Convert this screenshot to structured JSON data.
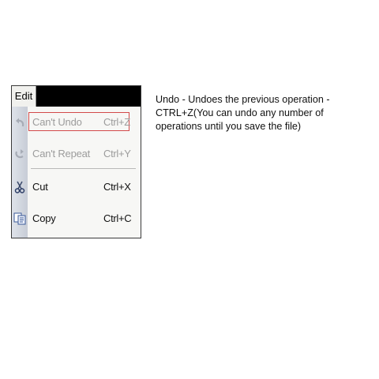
{
  "menu": {
    "title": "Edit",
    "items": [
      {
        "label": "Can't Undo",
        "shortcut": "Ctrl+Z",
        "icon": "undo-arrow-icon",
        "enabled": false
      },
      {
        "label": "Can't Repeat",
        "shortcut": "Ctrl+Y",
        "icon": "repeat-arrow-icon",
        "enabled": false
      },
      {
        "label": "Cut",
        "shortcut": "Ctrl+X",
        "icon": "scissors-icon",
        "enabled": true
      },
      {
        "label": "Copy",
        "shortcut": "Ctrl+C",
        "icon": "copy-icon",
        "enabled": true
      }
    ]
  },
  "colors": {
    "highlight": "#d24a4a",
    "disabled_text": "#9c9c9c"
  },
  "description": {
    "text": "Undo - Undoes the previous operation - CTRL+Z(You can undo any number of operations until you save the file)"
  }
}
